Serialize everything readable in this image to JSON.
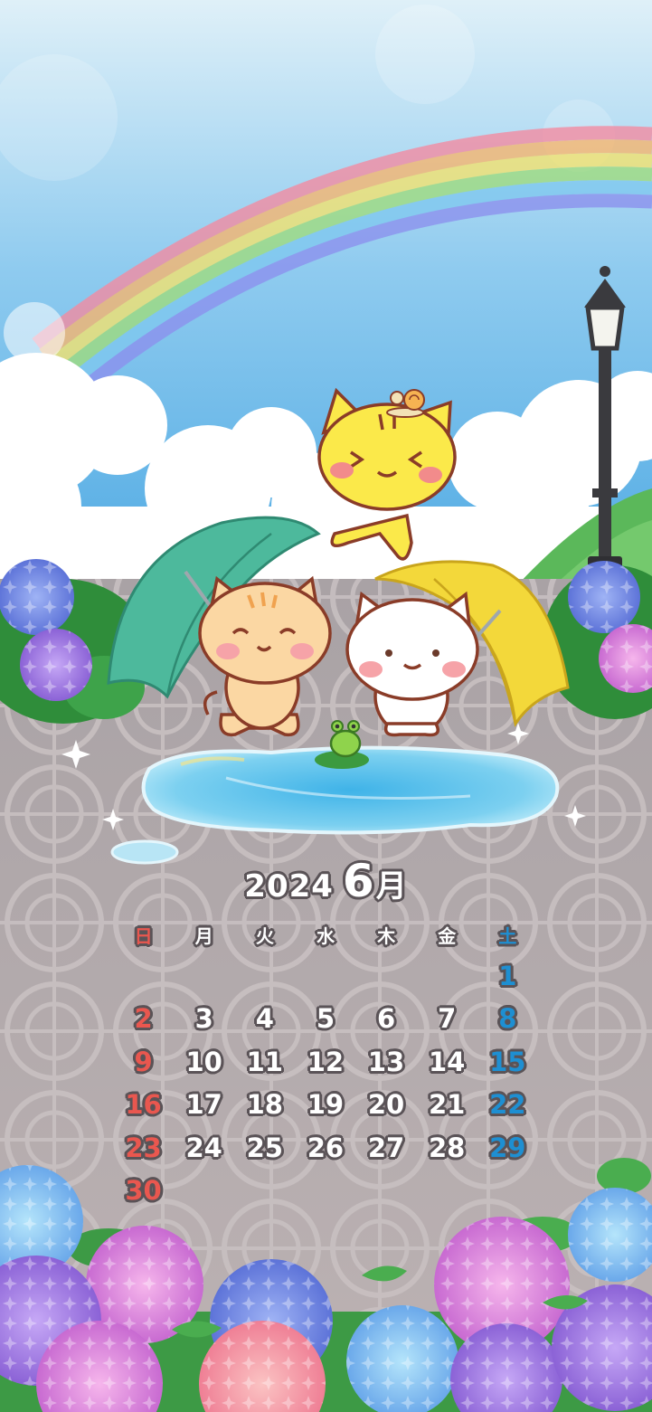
{
  "image": "Cats with umbrellas by a puddle under a rainbow, June 2024 calendar wallpaper",
  "calendar": {
    "year": "2024",
    "month": "6",
    "month_unit": "月",
    "weekdays": [
      "日",
      "月",
      "火",
      "水",
      "木",
      "金",
      "土"
    ],
    "weeks": [
      [
        "",
        "",
        "",
        "",
        "",
        "",
        "1"
      ],
      [
        "2",
        "3",
        "4",
        "5",
        "6",
        "7",
        "8"
      ],
      [
        "9",
        "10",
        "11",
        "12",
        "13",
        "14",
        "15"
      ],
      [
        "16",
        "17",
        "18",
        "19",
        "20",
        "21",
        "22"
      ],
      [
        "23",
        "24",
        "25",
        "26",
        "27",
        "28",
        "29"
      ],
      [
        "30",
        "",
        "",
        "",
        "",
        "",
        ""
      ]
    ]
  },
  "colors": {
    "sunday": "#e9574f",
    "saturday": "#1e8fd2",
    "weekday": "#ffffff",
    "text_outline": "#5a5357",
    "sky_top": "#cfe8f6",
    "sky_bottom": "#5fb2e6",
    "pavement": "#b8afb0",
    "green_umbrella": "#4db99c",
    "yellow_umbrella": "#f3d83a"
  }
}
